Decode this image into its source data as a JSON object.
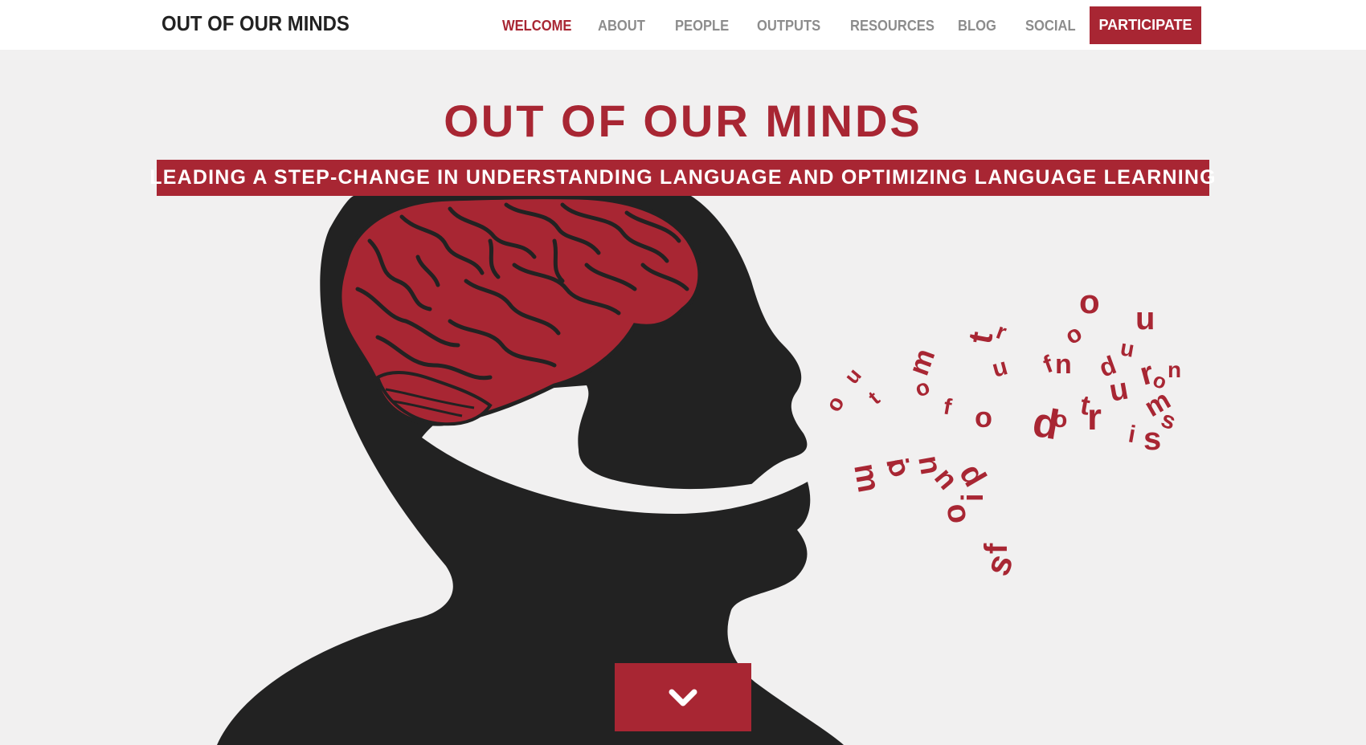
{
  "nav": {
    "brand": "OUT OF OUR MINDS",
    "items": [
      {
        "label": "WELCOME",
        "active": true
      },
      {
        "label": "ABOUT",
        "active": false
      },
      {
        "label": "PEOPLE",
        "active": false
      },
      {
        "label": "OUTPUTS",
        "active": false
      },
      {
        "label": "RESOURCES",
        "active": false
      },
      {
        "label": "BLOG",
        "active": false
      },
      {
        "label": "SOCIAL",
        "active": false
      }
    ],
    "cta_label": "PARTICIPATE"
  },
  "hero": {
    "title": "OUT OF OUR MINDS",
    "tagline": "LEADING A STEP-CHANGE IN UNDERSTANDING LANGUAGE AND OPTIMIZING LANGUAGE LEARNING",
    "speech_letters": [
      "o",
      "u",
      "t",
      "o",
      "f",
      "o",
      "u",
      "r",
      "m",
      "i",
      "n",
      "d",
      "s",
      "o",
      "u",
      "t",
      "o",
      "f",
      "o",
      "u",
      "r",
      "m",
      "i",
      "n",
      "d",
      "s",
      "o",
      "u",
      "t",
      "o",
      "f",
      "o",
      "u",
      "r",
      "m",
      "i",
      "n",
      "d",
      "s"
    ],
    "scroll_icon": "chevron-down-icon"
  },
  "colors": {
    "accent": "#a82633",
    "silhouette": "#222222",
    "background": "#f1f0f0",
    "nav_text": "#8c8c8c"
  }
}
